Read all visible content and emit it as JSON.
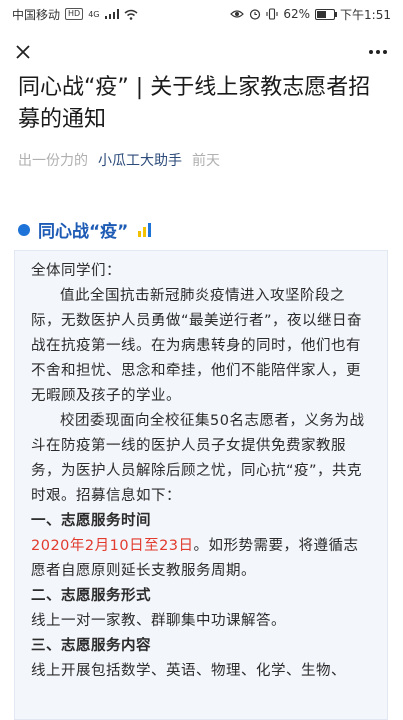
{
  "status_bar": {
    "carrier": "中国移动",
    "hd": "HD",
    "network": "4G",
    "battery": "62%",
    "battery_level": 0.62,
    "time": "下午1:51"
  },
  "nav": {
    "close_icon": "close-icon",
    "more_icon": "more-icon"
  },
  "article": {
    "title": "同心战“疫” | 关于线上家教志愿者招募的通知",
    "org": "出一份力的",
    "author": "小瓜工大助手",
    "time": "前天",
    "section_title": "同心战“疫”",
    "greeting": "全体同学们：",
    "para1": "值此全国抗击新冠肺炎疫情进入攻坚阶段之际，无数医护人员勇做“最美逆行者”，夜以继日奋战在抗疫第一线。在为病患转身的同时，他们也有不舍和担忧、思念和牵挂，他们不能陪伴家人，更无暇顾及孩子的学业。",
    "para2": "校团委现面向全校征集50名志愿者，义务为战斗在防疫第一线的医护人员子女提供免费家教服务，为医护人员解除后顾之忧，同心抗“疫”，共克时艰。招募信息如下：",
    "h1": "一、志愿服务时间",
    "date_red": "2020年2月10日至23日",
    "date_rest": "。如形势需要，将遵循志愿者自愿原则延长支教服务周期。",
    "h2": "二、志愿服务形式",
    "form": "线上一对一家教、群聊集中功课解答。",
    "h3": "三、志愿服务内容",
    "content": "线上开展包括数学、英语、物理、化学、生物、"
  },
  "colors": {
    "accent_blue": "#1e5bb5",
    "highlight_red": "#e23b2e",
    "card_bg": "#f3f6fb"
  }
}
